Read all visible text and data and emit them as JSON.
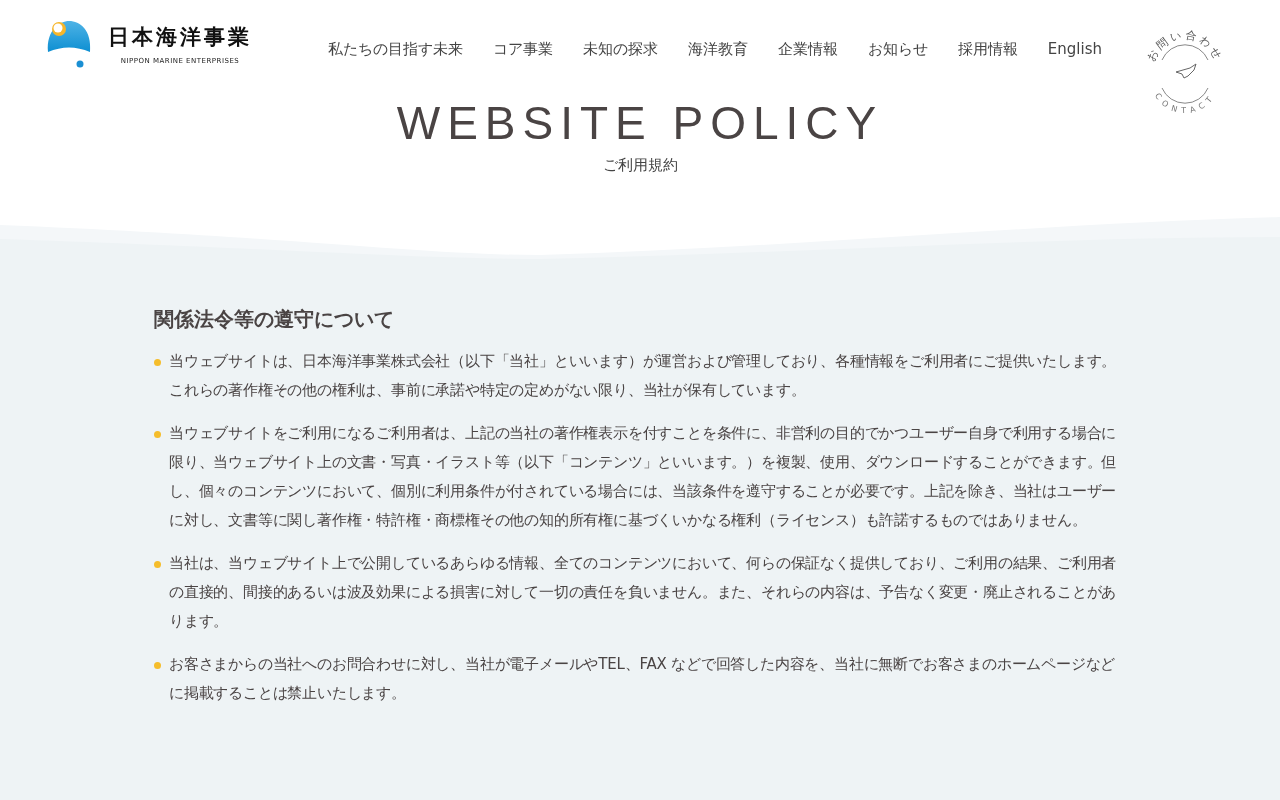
{
  "logo": {
    "name": "日本海洋事業",
    "subtitle": "NIPPON MARINE ENTERPRISES"
  },
  "nav": [
    {
      "label": "私たちの目指す未来"
    },
    {
      "label": "コア事業"
    },
    {
      "label": "未知の探求"
    },
    {
      "label": "海洋教育"
    },
    {
      "label": "企業情報"
    },
    {
      "label": "お知らせ"
    },
    {
      "label": "採用情報"
    },
    {
      "label": "English"
    }
  ],
  "contact": {
    "label_top": "お問い合わせ",
    "label_bottom": "CONTACT"
  },
  "hero": {
    "title": "WEBSITE POLICY",
    "subtitle": "ご利用規約"
  },
  "section": {
    "heading": "関係法令等の遵守について",
    "items": [
      "当ウェブサイトは、日本海洋事業株式会社（以下「当社」といいます）が運営および管理しており、各種情報をご利用者にご提供いたします。これらの著作権その他の権利は、事前に承諾や特定の定めがない限り、当社が保有しています。",
      "当ウェブサイトをご利用になるご利用者は、上記の当社の著作権表示を付すことを条件に、非営利の目的でかつユーザー自身で利用する場合に限り、当ウェブサイト上の文書・写真・イラスト等（以下「コンテンツ」といいます。）を複製、使用、ダウンロードすることができます。但し、個々のコンテンツにおいて、個別に利用条件が付されている場合には、当該条件を遵守することが必要です。上記を除き、当社はユーザーに対し、文書等に関し著作権・特許権・商標権その他の知的所有権に基づくいかなる権利（ライセンス）も許諾するものではありません。",
      "当社は、当ウェブサイト上で公開しているあらゆる情報、全てのコンテンツにおいて、何らの保証なく提供しており、ご利用の結果、ご利用者の直接的、間接的あるいは波及効果による損害に対して一切の責任を負いません。また、それらの内容は、予告なく変更・廃止されることがあります。",
      "お客さまからの当社へのお問合わせに対し、当社が電子メールやTEL、FAX などで回答した内容を、当社に無断でお客さまのホームページなどに掲載することは禁止いたします。"
    ]
  }
}
